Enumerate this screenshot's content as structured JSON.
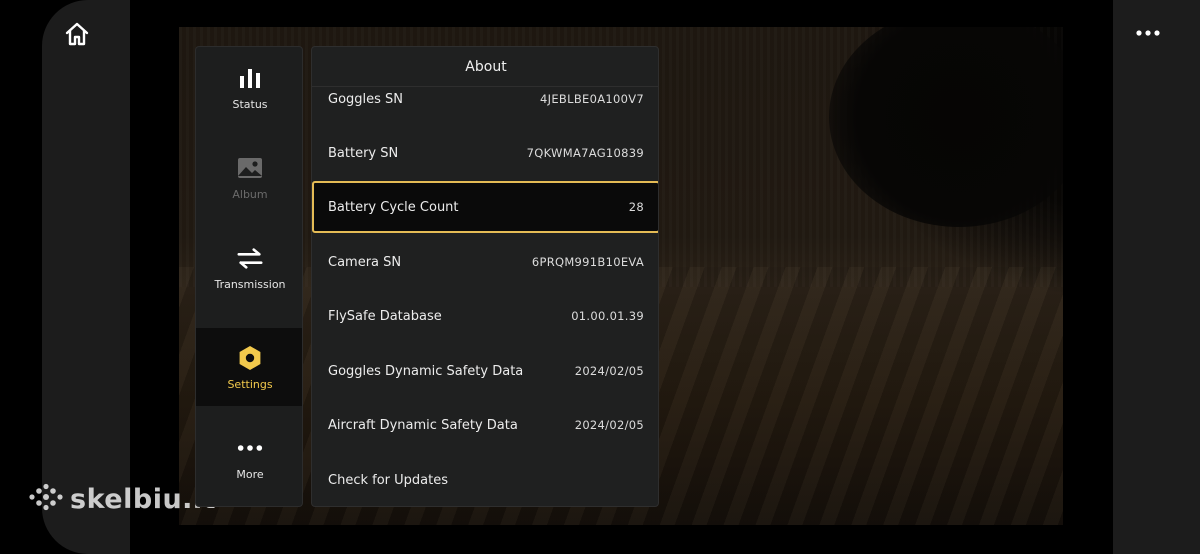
{
  "panel": {
    "title": "About"
  },
  "menu": [
    {
      "label": "Status",
      "icon": "bar-chart-icon",
      "state": "normal"
    },
    {
      "label": "Album",
      "icon": "image-icon",
      "state": "disabled"
    },
    {
      "label": "Transmission",
      "icon": "swap-arrows-icon",
      "state": "normal"
    },
    {
      "label": "Settings",
      "icon": "settings-hexagon-icon",
      "state": "active"
    },
    {
      "label": "More",
      "icon": "more-dots-icon",
      "state": "normal"
    }
  ],
  "rows": [
    {
      "label": "Goggles SN",
      "value": "4JEBLBE0A100V7"
    },
    {
      "label": "Battery SN",
      "value": "7QKWMA7AG10839"
    },
    {
      "label": "Battery Cycle Count",
      "value": "28",
      "selected": true
    },
    {
      "label": "Camera SN",
      "value": "6PRQM991B10EVA"
    },
    {
      "label": "FlySafe Database",
      "value": "01.00.01.39"
    },
    {
      "label": "Goggles Dynamic Safety Data",
      "value": "2024/02/05"
    },
    {
      "label": "Aircraft Dynamic Safety Data",
      "value": "2024/02/05"
    },
    {
      "label": "Check for Updates",
      "value": ""
    }
  ],
  "watermark": {
    "text": "skelbiu.lt"
  },
  "colors": {
    "accent": "#f2c94c",
    "selection_border": "#e4bb55"
  }
}
